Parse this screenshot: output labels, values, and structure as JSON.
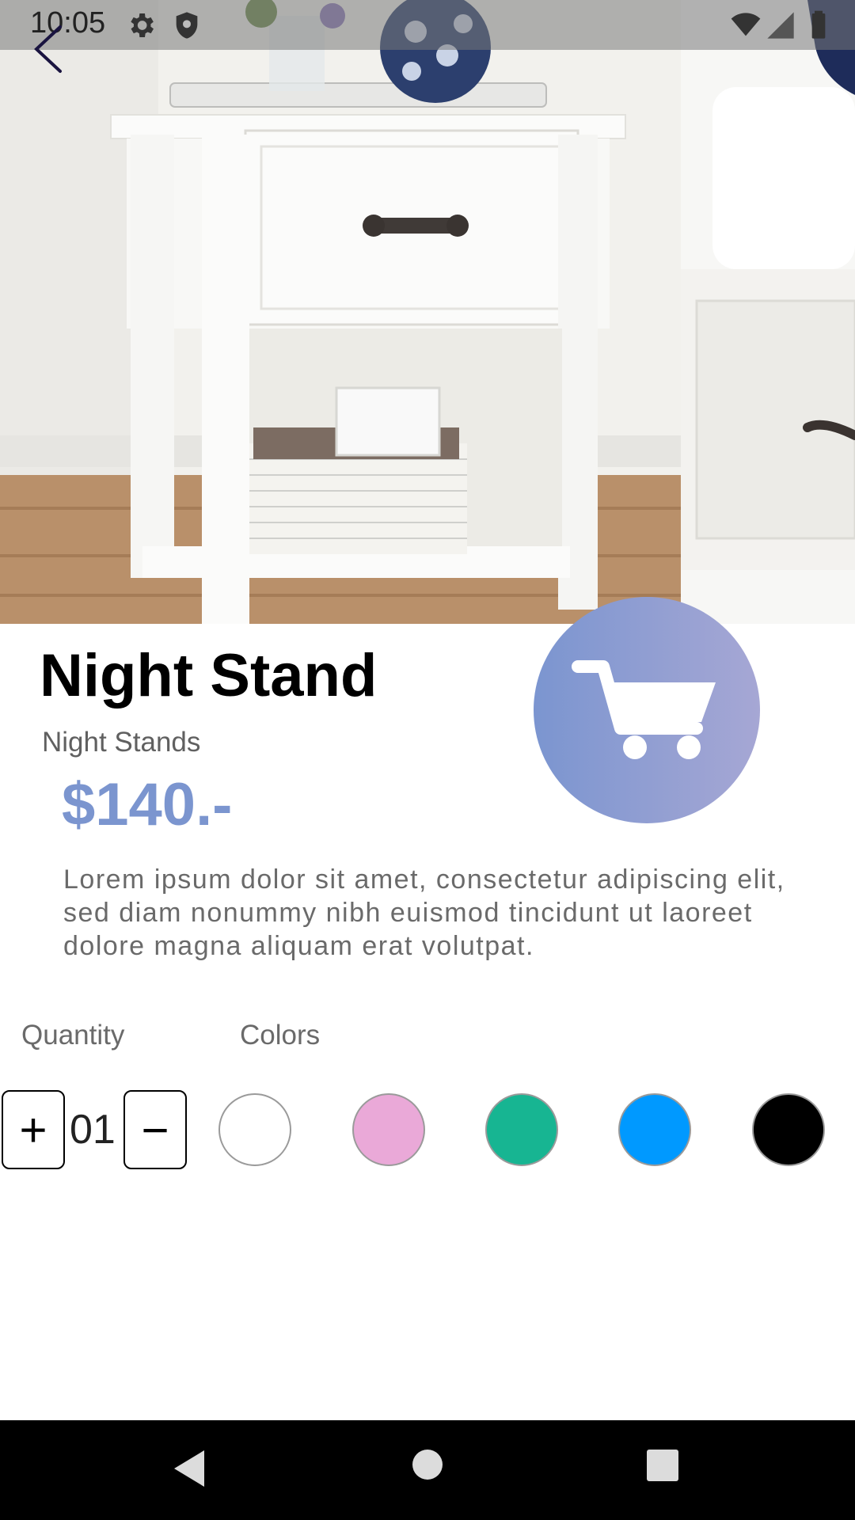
{
  "status_bar": {
    "time": "10:05",
    "icons": [
      "settings-icon",
      "shield-icon",
      "wifi-icon",
      "signal-icon",
      "battery-icon"
    ]
  },
  "product": {
    "title": "Night Stand",
    "category": "Night Stands",
    "price": "$140.-",
    "description": "Lorem ipsum dolor sit amet, consectetur adipiscing elit, sed diam nonummy nibh euismod tincidunt ut laoreet dolore magna aliquam erat volutpat."
  },
  "options": {
    "quantity_label": "Quantity",
    "colors_label": "Colors",
    "quantity_value": "01",
    "increment_symbol": "+",
    "decrement_symbol": "−",
    "colors": [
      "#ffffff",
      "#eaa9d8",
      "#17b592",
      "#0099ff",
      "#000000"
    ]
  },
  "theme": {
    "accent": "#7b95cf",
    "cart_gradient": [
      "#7b95d0",
      "#a6a7d4"
    ]
  }
}
